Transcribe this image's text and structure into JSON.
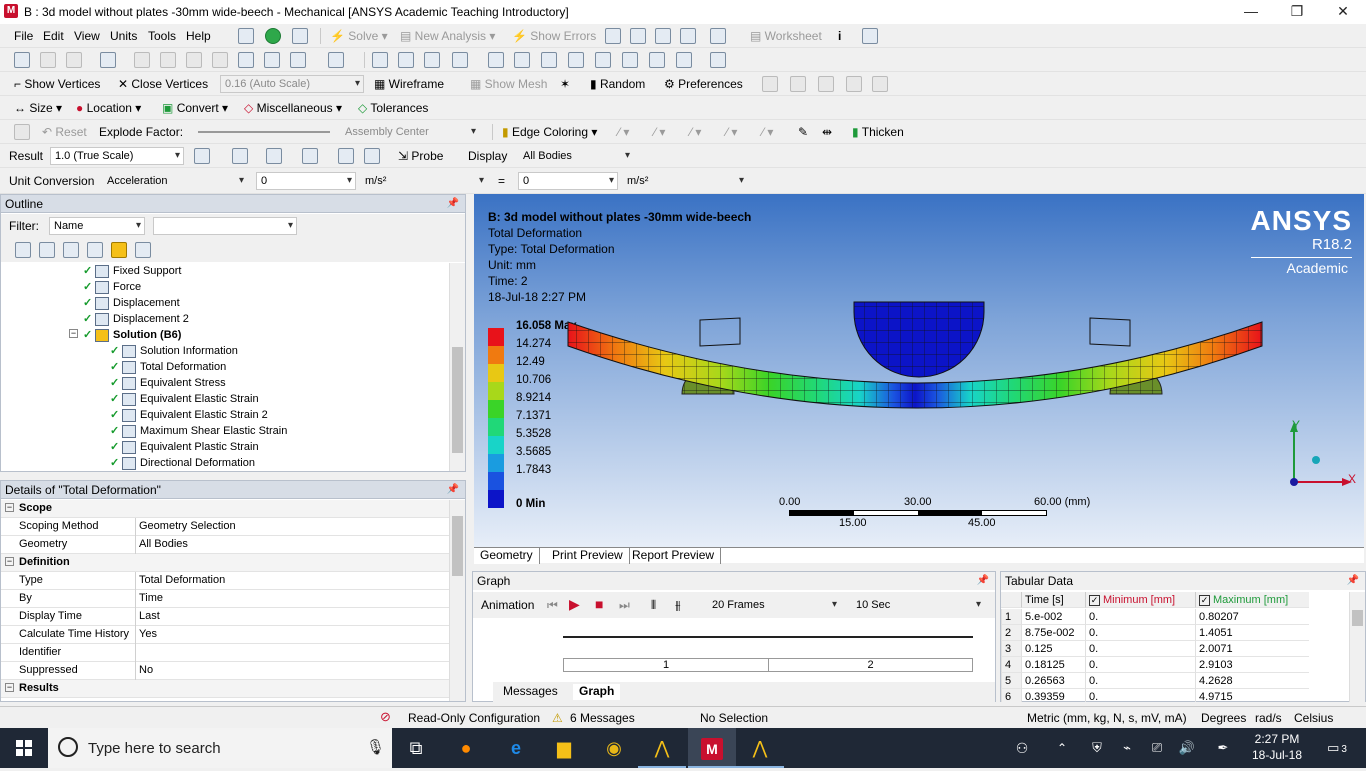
{
  "window": {
    "title": "B : 3d model without plates -30mm wide-beech - Mechanical [ANSYS Academic Teaching Introductory]",
    "logo": "M",
    "controls": [
      "—",
      "❐",
      "✕"
    ]
  },
  "menu": {
    "items": [
      "File",
      "Edit",
      "View",
      "Units",
      "Tools",
      "Help"
    ],
    "solve": "Solve",
    "new_analysis": "New Analysis",
    "show_errors": "Show Errors",
    "worksheet": "Worksheet"
  },
  "toolbar3": {
    "show_vertices": "Show Vertices",
    "close_vertices": "Close Vertices",
    "scale": "0.16 (Auto Scale)",
    "wireframe": "Wireframe",
    "show_mesh": "Show Mesh",
    "random": "Random",
    "preferences": "Preferences"
  },
  "toolbar4": {
    "size": "Size",
    "location": "Location",
    "convert": "Convert",
    "misc": "Miscellaneous",
    "tolerances": "Tolerances"
  },
  "toolbar5": {
    "reset": "Reset",
    "explode_factor": "Explode Factor:",
    "assembly_center": "Assembly Center",
    "edge_coloring": "Edge Coloring",
    "thicken": "Thicken"
  },
  "toolbar6": {
    "result": "Result",
    "scale": "1.0 (True Scale)",
    "probe": "Probe",
    "display": "Display",
    "all_bodies": "All Bodies"
  },
  "unit_conversion": {
    "label": "Unit Conversion",
    "quantity": "Acceleration",
    "value_left": "0",
    "unit_left": "m/s²",
    "equals": "=",
    "value_right": "0",
    "unit_right": "m/s²"
  },
  "outline": {
    "title": "Outline",
    "filter_label": "Filter:",
    "filter_value": "Name",
    "tree": [
      {
        "label": "Fixed Support",
        "level": 1
      },
      {
        "label": "Force",
        "level": 1
      },
      {
        "label": "Displacement",
        "level": 1
      },
      {
        "label": "Displacement 2",
        "level": 1
      },
      {
        "label": "Solution (B6)",
        "level": 1,
        "bold": true
      },
      {
        "label": "Solution Information",
        "level": 2
      },
      {
        "label": "Total Deformation",
        "level": 2,
        "selected": true
      },
      {
        "label": "Equivalent Stress",
        "level": 2
      },
      {
        "label": "Equivalent Elastic Strain",
        "level": 2
      },
      {
        "label": "Equivalent Elastic Strain 2",
        "level": 2
      },
      {
        "label": "Maximum Shear Elastic Strain",
        "level": 2
      },
      {
        "label": "Equivalent Plastic Strain",
        "level": 2
      },
      {
        "label": "Directional Deformation",
        "level": 2
      }
    ]
  },
  "details": {
    "title": "Details of \"Total Deformation\"",
    "rows": [
      {
        "section": "Scope"
      },
      {
        "key": "Scoping Method",
        "value": "Geometry Selection"
      },
      {
        "key": "Geometry",
        "value": "All Bodies"
      },
      {
        "section": "Definition"
      },
      {
        "key": "Type",
        "value": "Total Deformation"
      },
      {
        "key": "By",
        "value": "Time"
      },
      {
        "key": "Display Time",
        "value": "Last"
      },
      {
        "key": "Calculate Time History",
        "value": "Yes"
      },
      {
        "key": "Identifier",
        "value": ""
      },
      {
        "key": "Suppressed",
        "value": "No"
      },
      {
        "section": "Results"
      }
    ]
  },
  "viewport": {
    "info": [
      "B: 3d model without plates -30mm wide-beech",
      "Total Deformation",
      "Type: Total Deformation",
      "Unit: mm",
      "Time: 2",
      "18-Jul-18 2:27 PM"
    ],
    "ansys": "ANSYS",
    "version": "R18.2",
    "edition": "Academic",
    "legend": [
      {
        "label": "16.058 Max",
        "color": "#e8121a"
      },
      {
        "label": "14.274",
        "color": "#f07a10"
      },
      {
        "label": "12.49",
        "color": "#e8c814"
      },
      {
        "label": "10.706",
        "color": "#a8d81a"
      },
      {
        "label": "8.9214",
        "color": "#3ad428"
      },
      {
        "label": "7.1371",
        "color": "#20d878"
      },
      {
        "label": "5.3528",
        "color": "#18d4c8"
      },
      {
        "label": "3.5685",
        "color": "#1a9ce0"
      },
      {
        "label": "1.7843",
        "color": "#1a52e0"
      },
      {
        "label": "0 Min",
        "color": "#0c14c8"
      }
    ],
    "scale_top": [
      "0.00",
      "30.00",
      "60.00 (mm)"
    ],
    "scale_bottom": [
      "15.00",
      "45.00"
    ],
    "axes": {
      "y": "Y",
      "x": "X"
    },
    "tabs": [
      "Geometry",
      "Print Preview",
      "Report Preview"
    ]
  },
  "graph": {
    "title": "Graph",
    "animation": "Animation",
    "frames": "20 Frames",
    "duration": "10 Sec",
    "ticks": [
      "1",
      "2"
    ],
    "tabs": [
      "Messages",
      "Graph"
    ]
  },
  "tabular": {
    "title": "Tabular Data",
    "headers": [
      "Time [s]",
      "Minimum [mm]",
      "Maximum [mm]"
    ],
    "rows": [
      [
        "1",
        "5.e-002",
        "0.",
        "0.80207"
      ],
      [
        "2",
        "8.75e-002",
        "0.",
        "1.4051"
      ],
      [
        "3",
        "0.125",
        "0.",
        "2.0071"
      ],
      [
        "4",
        "0.18125",
        "0.",
        "2.9103"
      ],
      [
        "5",
        "0.26563",
        "0.",
        "4.2628"
      ],
      [
        "6",
        "0.39359",
        "0.",
        "4.9715"
      ]
    ]
  },
  "status": {
    "readonly": "Read-Only Configuration",
    "messages": "6 Messages",
    "selection": "No Selection",
    "units": "Metric (mm, kg, N, s, mV, mA)",
    "degrees": "Degrees",
    "rads": "rad/s",
    "temp": "Celsius"
  },
  "taskbar": {
    "search_placeholder": "Type here to search",
    "time": "2:27 PM",
    "date": "18-Jul-18",
    "notifications": "3"
  }
}
